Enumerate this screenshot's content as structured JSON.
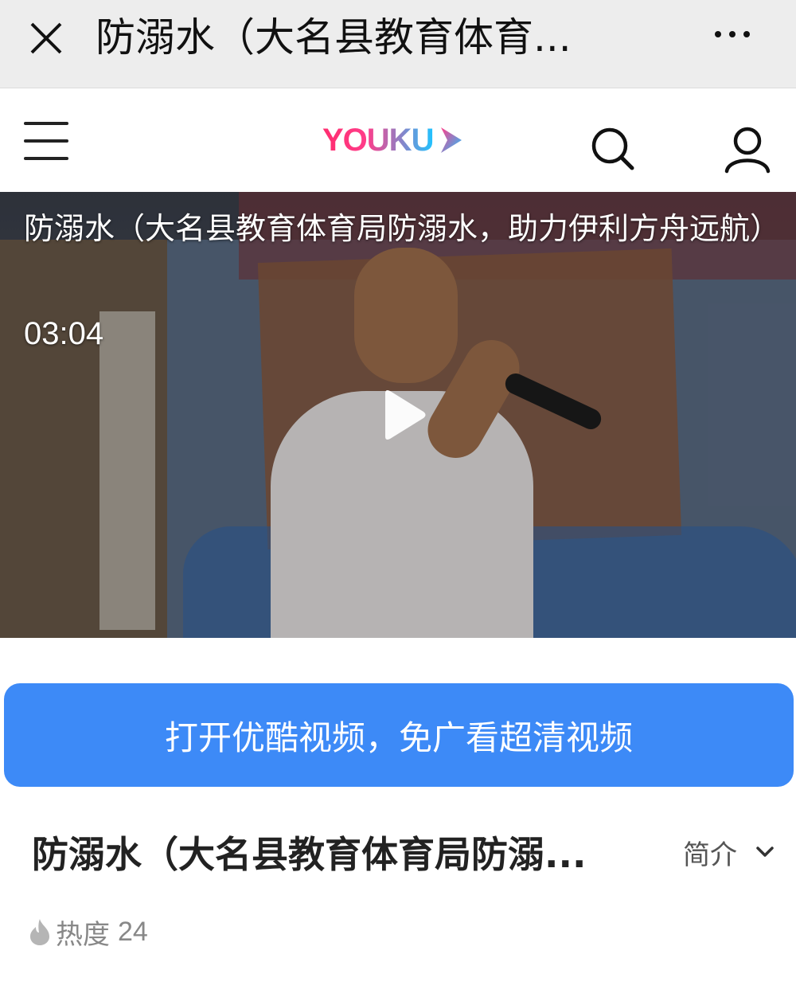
{
  "topbar": {
    "title": "防溺水（大名县教育体育...",
    "close_icon": "close-icon",
    "more_icon": "more-horizontal-icon"
  },
  "header": {
    "logo_text": "YOUKU",
    "menu_icon": "hamburger-menu-icon",
    "search_icon": "search-icon",
    "user_icon": "user-icon",
    "brand_colors": [
      "#ff2d6f",
      "#20c3ff"
    ]
  },
  "player": {
    "title": "防溺水（大名县教育体育局防溺水，助力伊利方舟远航）",
    "duration": "03:04",
    "play_icon": "play-icon"
  },
  "open_app": {
    "label": "打开优酷视频，免广看超清视频",
    "color": "#3d8af7"
  },
  "info": {
    "title": "防溺水（大名县教育体育局防溺...",
    "intro_label": "简介",
    "intro_icon": "chevron-down-icon",
    "heat_label": "热度",
    "heat_value": "24",
    "heat_icon": "flame-icon"
  }
}
